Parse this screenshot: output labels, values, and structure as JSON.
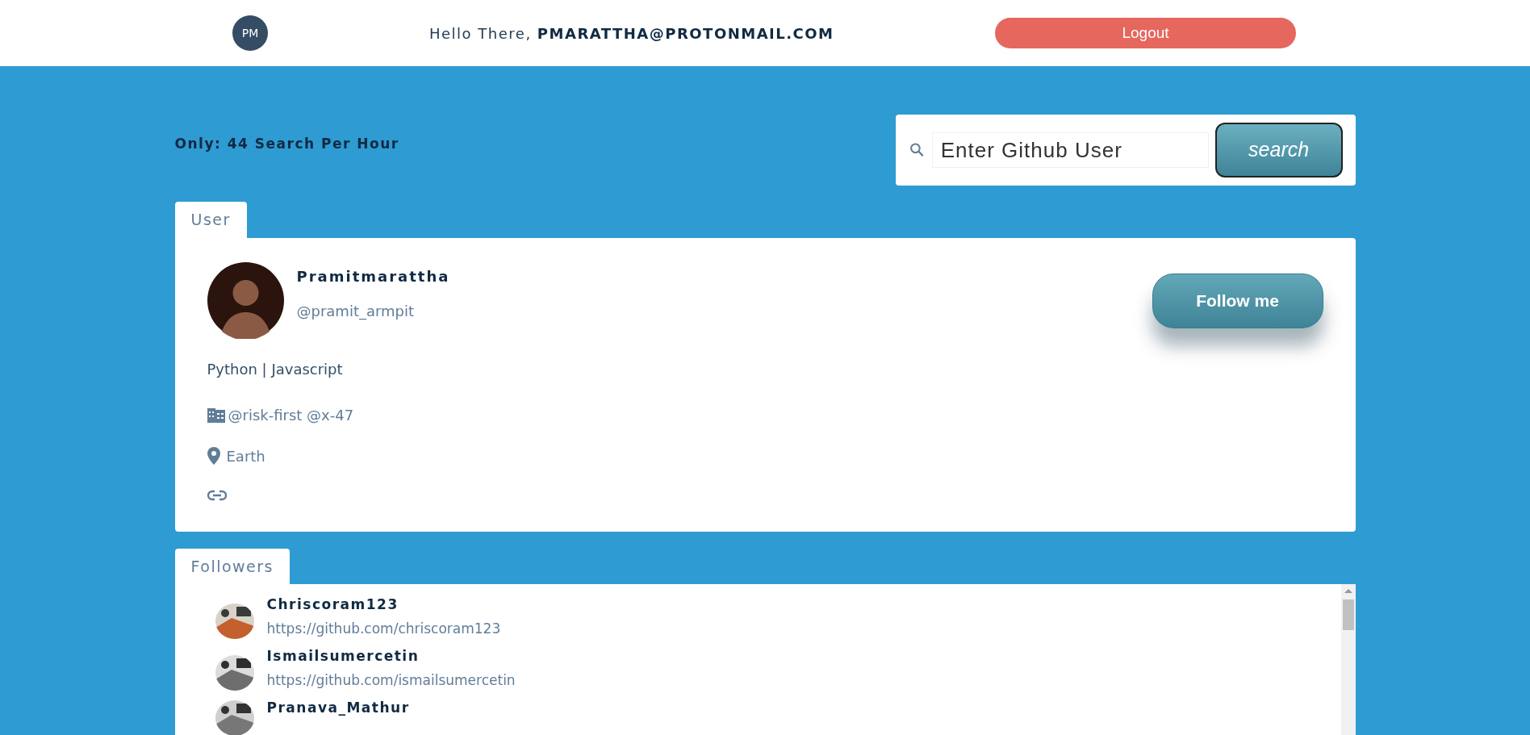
{
  "header": {
    "avatar_initials": "PM",
    "greeting": "Hello There, ",
    "email": "PMARATTHA@PROTONMAIL.COM",
    "logout": "Logout"
  },
  "rate_limit": "Only: 44 Search Per Hour",
  "search": {
    "placeholder": "Enter Github User",
    "button": "search"
  },
  "user_tab": {
    "label": "User"
  },
  "user": {
    "name": "Pramitmarattha",
    "login": "@pramit_armpit",
    "bio": "Python | Javascript",
    "company": "@risk-first @x-47",
    "location": "Earth",
    "follow": "Follow me"
  },
  "followers_tab": {
    "label": "Followers"
  },
  "followers": [
    {
      "name": "Chriscoram123",
      "url": "https://github.com/chriscoram123"
    },
    {
      "name": "Ismailsumercetin",
      "url": "https://github.com/ismailsumercetin"
    },
    {
      "name": "Pranava_Mathur"
    }
  ]
}
